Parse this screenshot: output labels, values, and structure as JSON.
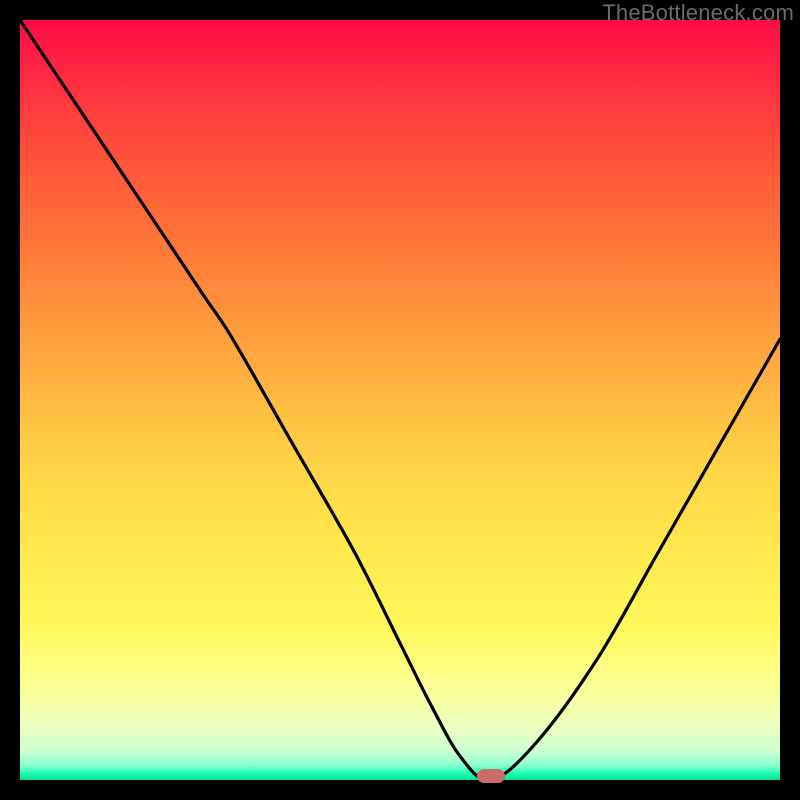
{
  "watermark": "TheBottleneck.com",
  "colors": {
    "marker": "#cc6b6b",
    "curve": "#000000"
  },
  "chart_data": {
    "type": "line",
    "title": "",
    "xlabel": "",
    "ylabel": "",
    "xlim": [
      0,
      100
    ],
    "ylim": [
      0,
      100
    ],
    "grid": false,
    "legend": false,
    "series": [
      {
        "name": "bottleneck-curve",
        "x": [
          0,
          8,
          16,
          24,
          28,
          36,
          44,
          50,
          54,
          58,
          62,
          68,
          76,
          84,
          92,
          100
        ],
        "values": [
          100,
          88,
          76,
          64,
          58,
          44,
          30,
          18,
          10,
          3,
          0,
          5,
          16,
          30,
          44,
          58
        ]
      }
    ],
    "marker": {
      "x": 62,
      "y": 0
    }
  }
}
